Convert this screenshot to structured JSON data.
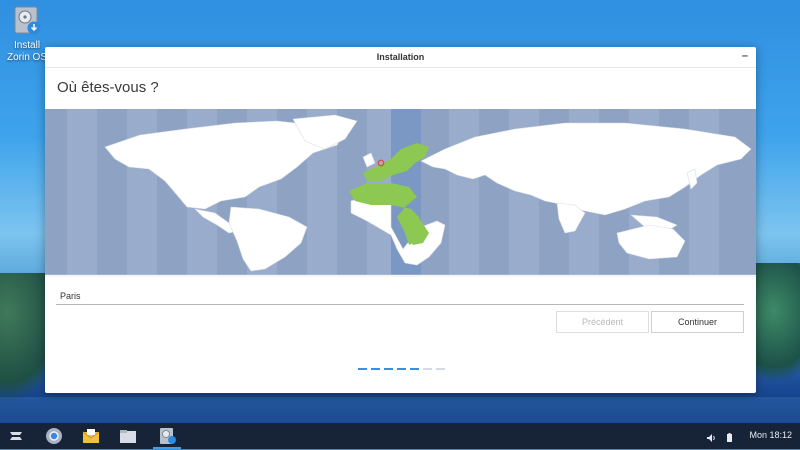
{
  "desktop": {
    "icon": {
      "label": "Install Zorin OS",
      "icon": "install-disk-icon"
    }
  },
  "window": {
    "title": "Installation",
    "minimize": "–",
    "heading": "Où êtes-vous ?",
    "map": {
      "selected_zone_color": "#8dc952",
      "highlight_band_color": "#7b98c4",
      "marker_color": "#e0453a"
    },
    "city_input": {
      "value": "Paris"
    },
    "buttons": {
      "previous": "Précédent",
      "next": "Continuer"
    },
    "progress": {
      "total_steps": 7,
      "current_step": 5
    }
  },
  "taskbar": {
    "apps": [
      "zorin-menu-icon",
      "chromium-icon",
      "mail-icon",
      "files-icon",
      "installer-icon"
    ],
    "tray": [
      "volume-icon",
      "battery-icon"
    ],
    "clock": "Mon 18:12"
  },
  "colors": {
    "accent": "#3b8ee0",
    "taskbar": "#172438"
  }
}
